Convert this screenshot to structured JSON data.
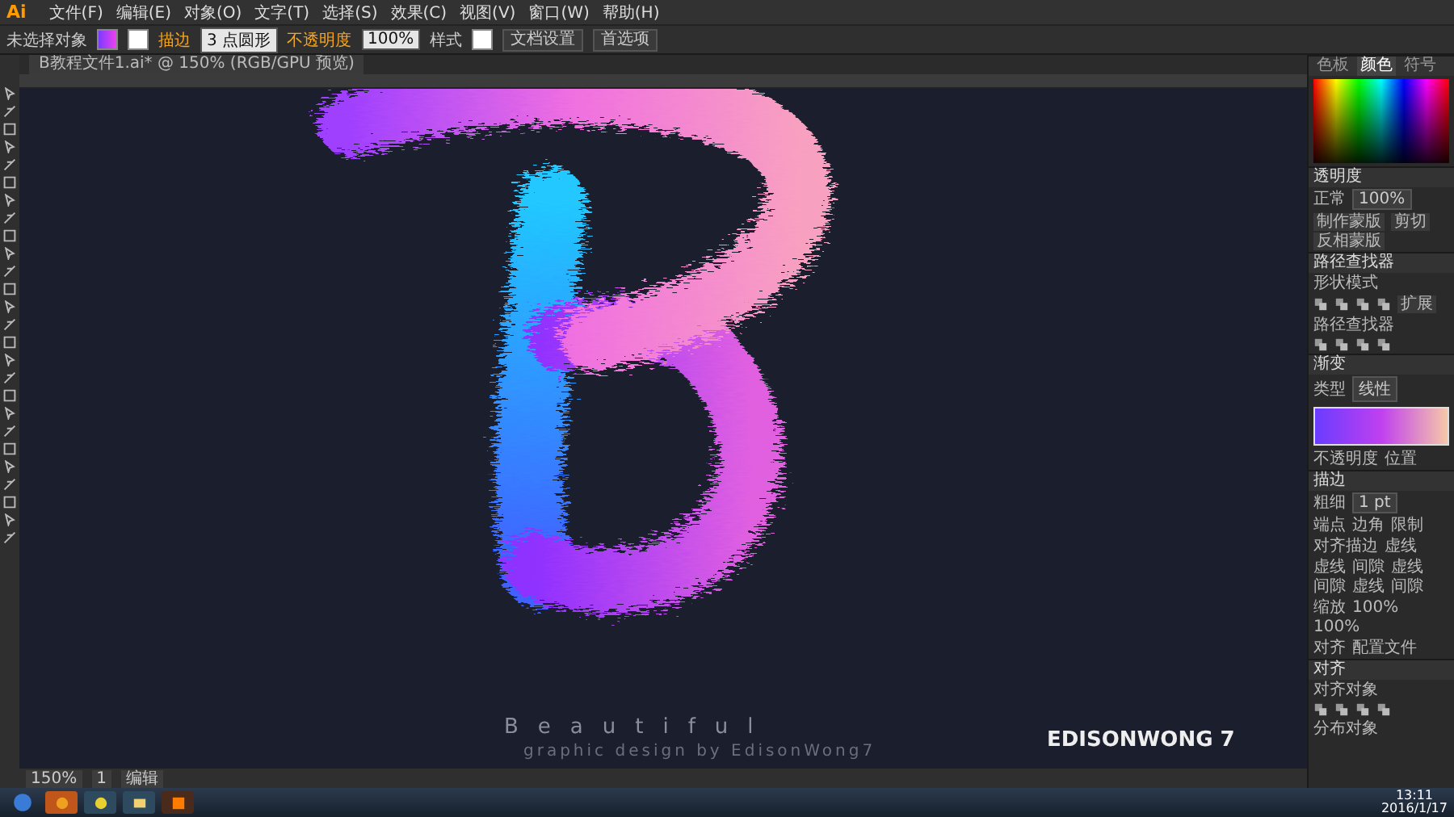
{
  "app_logo": "Ai",
  "menu": [
    "文件(F)",
    "编辑(E)",
    "对象(O)",
    "文字(T)",
    "选择(S)",
    "效果(C)",
    "视图(V)",
    "窗口(W)",
    "帮助(H)"
  ],
  "control_bar": {
    "selection": "未选择对象",
    "stroke_label": "描边",
    "brush": "3 点圆形",
    "opacity_label": "不透明度",
    "opacity": "100%",
    "style_label": "样式",
    "buttons": [
      "文档设置",
      "首选项"
    ]
  },
  "document_tab": {
    "title": "B教程文件1.ai* @ 150% (RGB/GPU 预览)"
  },
  "canvas": {
    "title": "Beautiful",
    "credit": "graphic design by EdisonWong7",
    "signature": "EDISONWONG 7"
  },
  "panels": [
    {
      "tabs": [
        {
          "label": "色板",
          "selected": false
        },
        {
          "label": "颜色",
          "selected": true
        },
        {
          "label": "符号",
          "selected": false
        }
      ],
      "rows": [
        {
          "kind": "spectrum"
        }
      ]
    },
    {
      "title": "透明度",
      "rows": [
        {
          "kind": "field",
          "label": "正常",
          "value": "100%"
        },
        {
          "kind": "buttons",
          "items": [
            "制作蒙版",
            "剪切",
            "反相蒙版"
          ]
        }
      ]
    },
    {
      "title": "路径查找器",
      "rows": [
        {
          "kind": "labels",
          "items": [
            "形状模式"
          ]
        },
        {
          "kind": "icons",
          "items": [
            "扩展"
          ]
        },
        {
          "kind": "labels",
          "items": [
            "路径查找器"
          ]
        },
        {
          "kind": "icons",
          "items": []
        }
      ]
    },
    {
      "title": "渐变",
      "rows": [
        {
          "kind": "field",
          "label": "类型",
          "value": "线性"
        },
        {
          "kind": "gradient"
        },
        {
          "kind": "labels",
          "items": [
            "不透明度",
            "位置"
          ]
        }
      ]
    },
    {
      "title": "描边",
      "rows": [
        {
          "kind": "field",
          "label": "粗细",
          "value": "1 pt"
        },
        {
          "kind": "labels",
          "items": [
            "端点",
            "边角",
            "限制"
          ]
        },
        {
          "kind": "labels",
          "items": [
            "对齐描边",
            "虚线"
          ]
        },
        {
          "kind": "labels",
          "items": [
            "虚线",
            "间隙",
            "虚线",
            "间隙",
            "虚线",
            "间隙"
          ]
        },
        {
          "kind": "labels",
          "items": [
            "缩放",
            "100%",
            "100%"
          ]
        },
        {
          "kind": "labels",
          "items": [
            "对齐",
            "配置文件"
          ]
        }
      ]
    },
    {
      "title": "对齐",
      "rows": [
        {
          "kind": "labels",
          "items": [
            "对齐对象"
          ]
        },
        {
          "kind": "icons",
          "items": []
        },
        {
          "kind": "labels",
          "items": [
            "分布对象"
          ]
        }
      ]
    }
  ],
  "status_bar": {
    "zoom": "150%",
    "artboard": "1",
    "mode": "编辑"
  },
  "taskbar": {
    "time": "13:11",
    "date": "2016/1/17"
  }
}
